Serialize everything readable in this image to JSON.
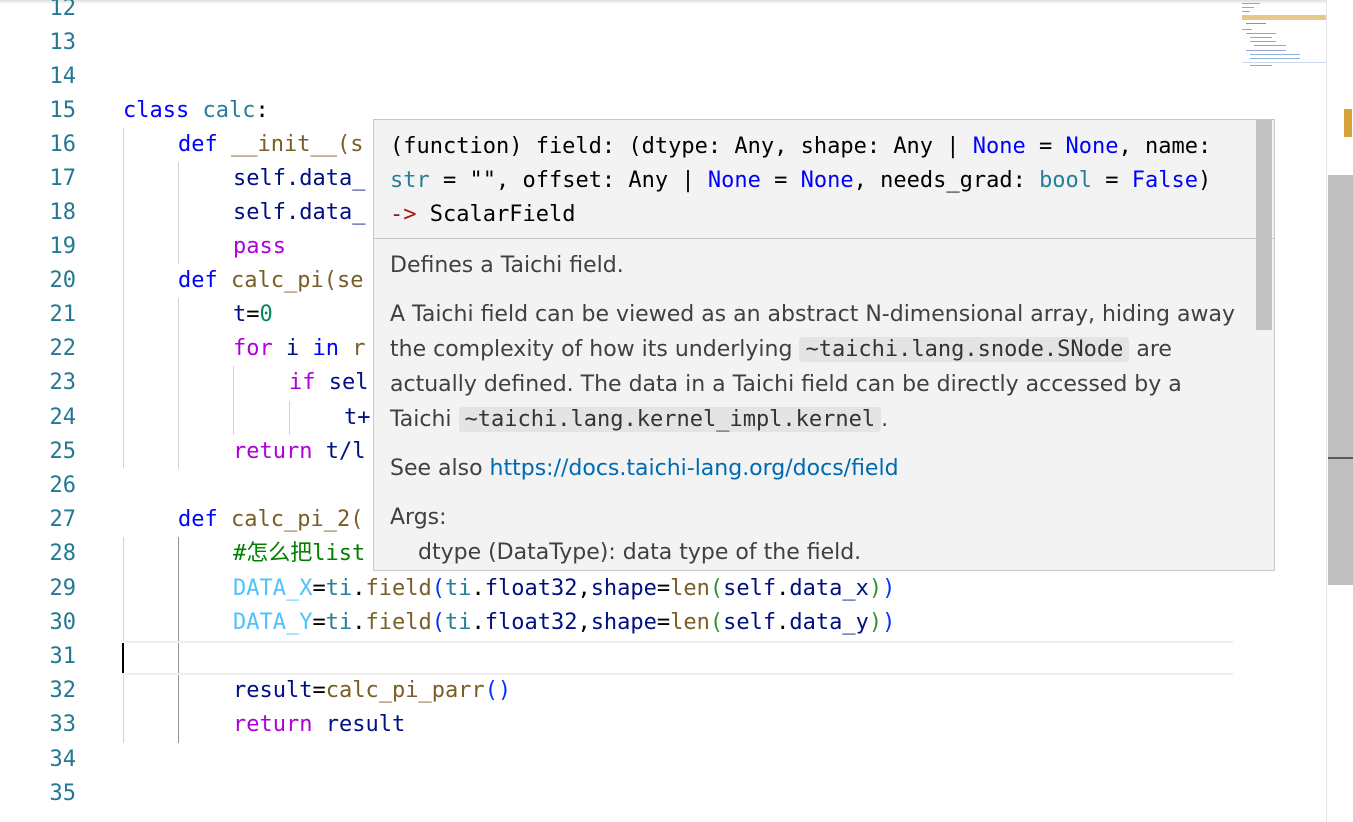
{
  "editor": {
    "line_numbers": [
      "12",
      "13",
      "14",
      "15",
      "16",
      "17",
      "18",
      "19",
      "20",
      "21",
      "22",
      "23",
      "24",
      "25",
      "26",
      "27",
      "28",
      "29",
      "30",
      "31",
      "32",
      "33",
      "34",
      "35"
    ],
    "code": {
      "l15_kw": "class",
      "l15_name": "calc",
      "l15_colon": ":",
      "l16_kw": "def",
      "l16_text": "__init__(s",
      "l17": "self.data_",
      "l18": "self.data_",
      "l19": "pass",
      "l20_kw": "def",
      "l20_fn": "calc_pi(se",
      "l21_var": "t",
      "l21_op": "=",
      "l21_num": "0",
      "l22_kw": "for",
      "l22_var": "i",
      "l22_in": "in",
      "l22_rest": "r",
      "l23_kw": "if",
      "l23_rest": "sel",
      "l24": "t+",
      "l25_kw": "return",
      "l25_rest": "t/l",
      "l27_kw": "def",
      "l27_fn": "calc_pi_2(",
      "l28_comment": "#怎么把list",
      "l29_const": "DATA_X",
      "l29_eq": "=",
      "l29_mod": "ti",
      "l29_dot": ".",
      "l29_fn": "field",
      "l29_p1": "(",
      "l29_mod2": "ti",
      "l29_dot2": ".",
      "l29_type": "float32",
      "l29_comma": ",",
      "l29_kwarg": "shape",
      "l29_eq2": "=",
      "l29_len": "len",
      "l29_p2": "(",
      "l29_self": "self",
      "l29_dot3": ".",
      "l29_attr": "data_x",
      "l29_p3": ")",
      "l29_p4": ")",
      "l30_const": "DATA_Y",
      "l30_attr": "data_y",
      "l32_var": "result",
      "l32_eq": "=",
      "l32_fn": "calc_pi_parr",
      "l32_parens": "()",
      "l33_kw": "return",
      "l33_var": "result"
    }
  },
  "hover": {
    "sig_prefix": "(function) field: (dtype: Any, shape: Any | ",
    "sig_none1": "None",
    "sig_eq1": " = ",
    "sig_none2": "None",
    "sig_mid1": ", name: ",
    "sig_str": "str",
    "sig_mid2": " = \"\", offset: Any | ",
    "sig_none3": "None",
    "sig_eq2": " = ",
    "sig_none4": "None",
    "sig_mid3": ", needs_grad: ",
    "sig_bool": "bool",
    "sig_eq3": " = ",
    "sig_false": "False",
    "sig_close": ")",
    "sig_arrow": "->",
    "sig_return": " ScalarField",
    "doc_summary": "Defines a Taichi field.",
    "doc_p2_a": "A Taichi field can be viewed as an abstract N-dimensional array, hiding away the complexity of how its underlying ",
    "doc_p2_code1": "~taichi.lang.snode.SNode",
    "doc_p2_b": " are actually defined. The data in a Taichi field can be directly accessed by a Taichi ",
    "doc_p2_code2": "~taichi.lang.kernel_impl.kernel",
    "doc_p2_c": ".",
    "see_also": "See also ",
    "link": "https://docs.taichi-lang.org/docs/field",
    "args_heading": "Args:",
    "arg_dtype": "dtype (DataType): data type of the field."
  },
  "colors": {
    "keyword": "#0000ff",
    "control_keyword": "#af00db",
    "class_name": "#267f99",
    "function": "#795e26",
    "variable": "#001080",
    "constant": "#4fc1ff",
    "comment": "#008000",
    "line_number": "#237893",
    "link": "#006ab1",
    "hover_bg": "#f3f3f3"
  }
}
